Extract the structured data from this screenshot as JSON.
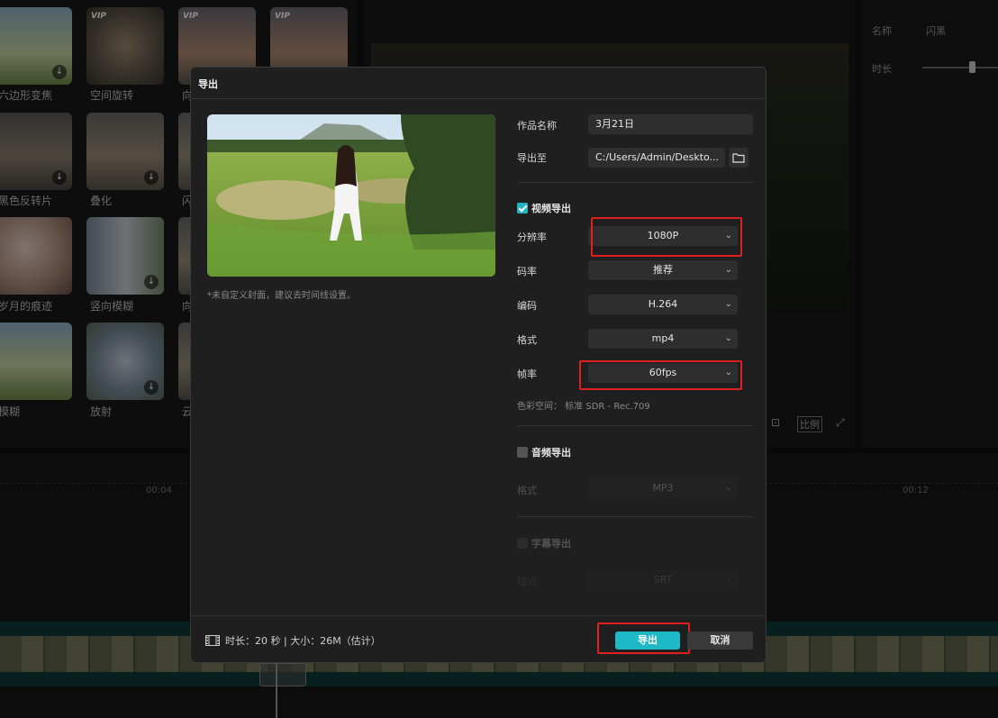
{
  "background": {
    "effects": [
      {
        "label": "六边形变焦",
        "vip": false
      },
      {
        "label": "空间旋转",
        "vip": true
      },
      {
        "label": "向",
        "vip": true
      },
      {
        "label": "",
        "vip": true
      },
      {
        "label": "黑色反转片",
        "vip": false
      },
      {
        "label": "叠化",
        "vip": false
      },
      {
        "label": "闪",
        "vip": false
      },
      {
        "label": "岁月的痕迹",
        "vip": false
      },
      {
        "label": "竖向模糊",
        "vip": false
      },
      {
        "label": "向",
        "vip": false
      },
      {
        "label": "模糊",
        "vip": false
      },
      {
        "label": "放射",
        "vip": false
      },
      {
        "label": "云",
        "vip": false
      }
    ],
    "vip_badge": "VIP",
    "properties": {
      "name_label": "名称",
      "name_value": "闪黑",
      "duration_label": "时长"
    },
    "preview_ratio_label": "比例",
    "ruler_ticks": [
      "00:04",
      "00:12"
    ]
  },
  "dialog": {
    "title": "导出",
    "cover_note": "*未自定义封面，建议去时间线设置。",
    "name_label": "作品名称",
    "name_value": "3月21日",
    "export_to_label": "导出至",
    "export_path": "C:/Users/Admin/Deskto...",
    "video_section": "视频导出",
    "video_enabled": true,
    "resolution_label": "分辨率",
    "resolution_value": "1080P",
    "bitrate_label": "码率",
    "bitrate_value": "推荐",
    "codec_label": "编码",
    "codec_value": "H.264",
    "format_label": "格式",
    "format_value": "mp4",
    "framerate_label": "帧率",
    "framerate_value": "60fps",
    "colorspace_text": "色彩空间：  标准 SDR - Rec.709",
    "audio_section": "音频导出",
    "audio_enabled": false,
    "audio_format_label": "格式",
    "audio_format_value": "MP3",
    "subtitle_section": "字幕导出",
    "subtitle_format_label": "格式",
    "subtitle_format_value": "SRT",
    "footer_info": "时长：20 秒 | 大小：26M（估计）",
    "export_button": "导出",
    "cancel_button": "取消"
  },
  "colors": {
    "accent": "#1fb8c6",
    "highlight": "#e02020"
  }
}
